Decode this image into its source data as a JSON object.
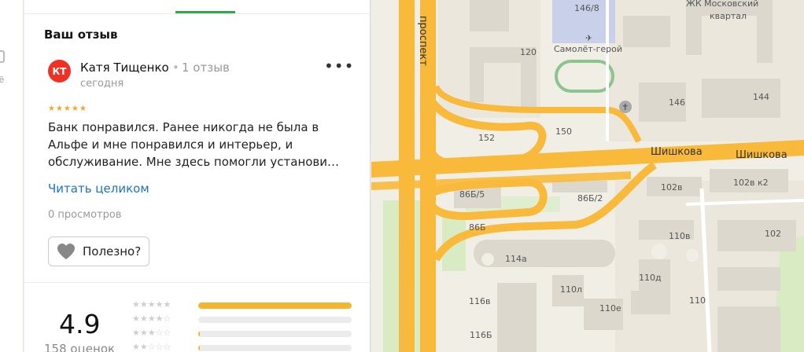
{
  "review": {
    "section_title": "Ваш отзыв",
    "avatar_initials": "КТ",
    "avatar_color": "#ef3124",
    "author": "Катя Тищенко",
    "reviews_count": "1 отзыв",
    "date": "сегодня",
    "rating": 5,
    "stars_text": "★★★★★",
    "text_lines": [
      "Банк понравился. Ранее никогда не была в",
      "Альфе и мне понравился и интерьер, и",
      "обслуживание. Мне здесь помогли установи…"
    ],
    "read_more": "Читать целиком",
    "views": "0 просмотров",
    "useful_label": "Полезно?",
    "more_icon": "more-dots-icon"
  },
  "summary": {
    "rating": "4.9",
    "count": "158 оценок",
    "distribution": [
      {
        "stars": 5,
        "fraction": 1.0
      },
      {
        "stars": 4,
        "fraction": 0.0
      },
      {
        "stars": 3,
        "fraction": 0.01
      },
      {
        "stars": 2,
        "fraction": 0.01
      }
    ]
  },
  "left_nav": {
    "partial_label": "ьё"
  },
  "map": {
    "labels": {
      "prospekt": "проспект",
      "zhk": "ЖК Московский",
      "kvartal": "квартал",
      "b146_8": "146/8",
      "samolet": "Самолёт-герой",
      "b120": "120",
      "b146": "146",
      "b144": "144",
      "b152": "152",
      "b150": "150",
      "shishkova1": "Шишкова",
      "shishkova2": "Шишкова",
      "b86b5": "86Б/5",
      "b86b2": "86Б/2",
      "b102v": "102в",
      "b102vk2": "102в к2",
      "b86b": "86Б",
      "b110v": "110в",
      "b102": "102",
      "b114a": "114а",
      "b110d": "110д",
      "b110l": "110л",
      "b116v": "116в",
      "b110e": "110е",
      "b116b": "116Б",
      "b110": "110"
    },
    "colors": {
      "road": "#f9b93a",
      "road_edge": "#e2a22a",
      "block": "#e6e2d6",
      "building": "#dedad0",
      "green": "#d6ebc0",
      "school": "#c7d0ea"
    }
  }
}
